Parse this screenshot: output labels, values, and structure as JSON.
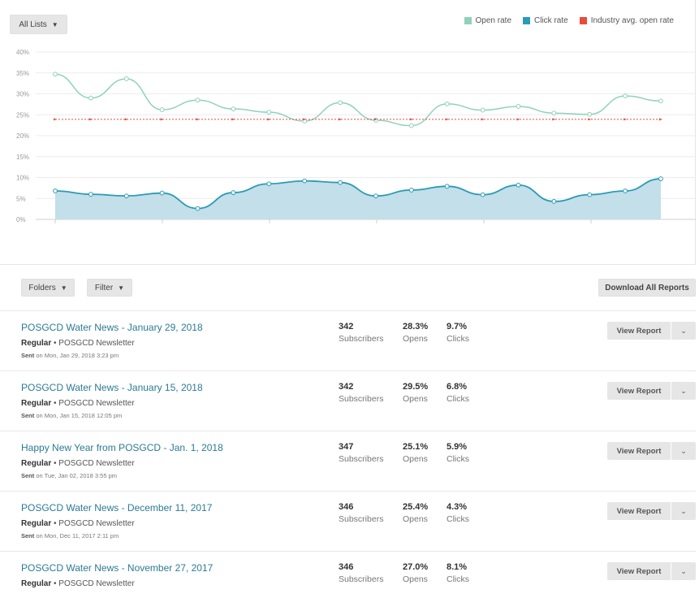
{
  "controls": {
    "all_lists_label": "All Lists",
    "folders_label": "Folders",
    "filter_label": "Filter",
    "download_label": "Download All Reports",
    "view_report_label": "View Report"
  },
  "legend": [
    {
      "label": "Open rate",
      "color": "#8fd2b9"
    },
    {
      "label": "Click rate",
      "color": "#2b9bb6"
    },
    {
      "label": "Industry avg. open rate",
      "color": "#e74c3c"
    }
  ],
  "chart_data": {
    "type": "line",
    "y_ticks": [
      "40%",
      "35%",
      "30%",
      "25%",
      "20%",
      "15%",
      "10%",
      "5%",
      "0%"
    ],
    "ylim": [
      0,
      40
    ],
    "grid": true,
    "legend_position": "top-right",
    "series": [
      {
        "name": "Open rate",
        "color": "#8fd2b9",
        "values": [
          34.7,
          29.0,
          33.6,
          26.2,
          28.5,
          26.4,
          25.6,
          23.5,
          27.9,
          23.7,
          22.4,
          27.6,
          26.1,
          27.0,
          25.4,
          25.1,
          29.5,
          28.3
        ]
      },
      {
        "name": "Click rate",
        "color": "#2b9bb6",
        "area": true,
        "values": [
          6.8,
          6.0,
          5.6,
          6.3,
          2.6,
          6.4,
          8.5,
          9.2,
          8.8,
          5.6,
          7.0,
          7.9,
          5.9,
          8.2,
          4.3,
          5.9,
          6.8,
          9.7
        ]
      },
      {
        "name": "Industry avg. open rate",
        "color": "#e74c3c",
        "dashed": true,
        "values": [
          23.9,
          23.9,
          23.9,
          23.9,
          23.9,
          23.9,
          23.9,
          23.9,
          23.9,
          23.9,
          23.9,
          23.9,
          23.9,
          23.9,
          23.9,
          23.9,
          23.9,
          23.9
        ]
      }
    ]
  },
  "campaigns": [
    {
      "title": "POSGCD Water News - January 29, 2018",
      "type": "Regular",
      "list": "• POSGCD Newsletter",
      "sent_prefix": "Sent",
      "sent": "on Mon, Jan 29, 2018 3:23 pm",
      "subscribers": "342",
      "subscribers_label": "Subscribers",
      "opens": "28.3%",
      "opens_label": "Opens",
      "clicks": "9.7%",
      "clicks_label": "Clicks"
    },
    {
      "title": "POSGCD Water News - January 15, 2018",
      "type": "Regular",
      "list": "• POSGCD Newsletter",
      "sent_prefix": "Sent",
      "sent": "on Mon, Jan 15, 2018 12:05 pm",
      "subscribers": "342",
      "subscribers_label": "Subscribers",
      "opens": "29.5%",
      "opens_label": "Opens",
      "clicks": "6.8%",
      "clicks_label": "Clicks"
    },
    {
      "title": "Happy New Year from POSGCD - Jan. 1, 2018",
      "type": "Regular",
      "list": "• POSGCD Newsletter",
      "sent_prefix": "Sent",
      "sent": "on Tue, Jan 02, 2018 3:55 pm",
      "subscribers": "347",
      "subscribers_label": "Subscribers",
      "opens": "25.1%",
      "opens_label": "Opens",
      "clicks": "5.9%",
      "clicks_label": "Clicks"
    },
    {
      "title": "POSGCD Water News - December 11, 2017",
      "type": "Regular",
      "list": "• POSGCD Newsletter",
      "sent_prefix": "Sent",
      "sent": "on Mon, Dec 11, 2017 2:11 pm",
      "subscribers": "346",
      "subscribers_label": "Subscribers",
      "opens": "25.4%",
      "opens_label": "Opens",
      "clicks": "4.3%",
      "clicks_label": "Clicks"
    },
    {
      "title": "POSGCD Water News - November 27, 2017",
      "type": "Regular",
      "list": "• POSGCD Newsletter",
      "sent_prefix": "",
      "sent": "",
      "subscribers": "346",
      "subscribers_label": "Subscribers",
      "opens": "27.0%",
      "opens_label": "Opens",
      "clicks": "8.1%",
      "clicks_label": "Clicks"
    }
  ]
}
